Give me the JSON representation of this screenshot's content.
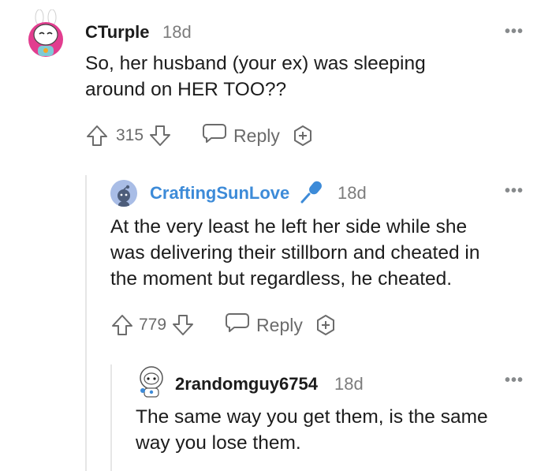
{
  "colors": {
    "text": "#1c1c1c",
    "muted": "#7c7c7c",
    "link_blue": "#3d8bd8",
    "thread_line": "#e6e6e6",
    "icon_gray": "#878a8c"
  },
  "comments": [
    {
      "username": "CTurple",
      "time": "18d",
      "more": "•••",
      "body_lines": [
        "So, her husband (your ex) was sleeping",
        "around on HER TOO??"
      ],
      "votes": "315",
      "reply_label": "Reply",
      "avatar_icon": "snoo-avatar-bunny-icon"
    },
    {
      "username": "CraftingSunLove",
      "time": "18d",
      "more": "•••",
      "badge_icon": "microphone-icon",
      "body_lines": [
        "At the very least he left her side while she",
        "was delivering their stillborn and cheated in",
        "the moment but regardless, he cheated."
      ],
      "votes": "779",
      "reply_label": "Reply",
      "avatar_icon": "default-snoo-avatar-icon"
    },
    {
      "username": "2randomguy6754",
      "time": "18d",
      "more": "•••",
      "body_lines": [
        "The same way you get them, is the same",
        "way you lose them."
      ],
      "avatar_icon": "astronaut-snoo-avatar-icon"
    }
  ]
}
